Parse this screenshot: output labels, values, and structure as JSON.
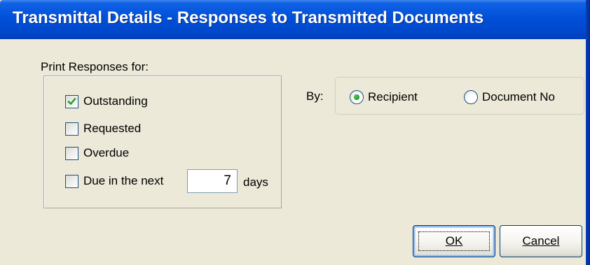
{
  "window": {
    "title": "Transmittal Details - Responses to Transmitted Documents"
  },
  "print_group": {
    "label": "Print Responses for:",
    "options": [
      {
        "label": "Outstanding",
        "checked": true
      },
      {
        "label": "Requested",
        "checked": false
      },
      {
        "label": "Overdue",
        "checked": false
      },
      {
        "label": "Due in the next",
        "checked": false
      }
    ],
    "days_value": "7",
    "days_label": "days"
  },
  "sort_group": {
    "label": "By:",
    "options": [
      {
        "label": "Recipient",
        "selected": true
      },
      {
        "label": "Document No",
        "selected": false
      }
    ]
  },
  "buttons": {
    "ok": "OK",
    "cancel": "Cancel"
  },
  "icons": {
    "checkmark": "check-icon",
    "radio_dot": "radio-dot-icon"
  },
  "colors": {
    "titlebar": "#0050d8",
    "window_bg": "#ece9d8",
    "control_border": "#1c5180",
    "radio_dot": "#21a121"
  }
}
